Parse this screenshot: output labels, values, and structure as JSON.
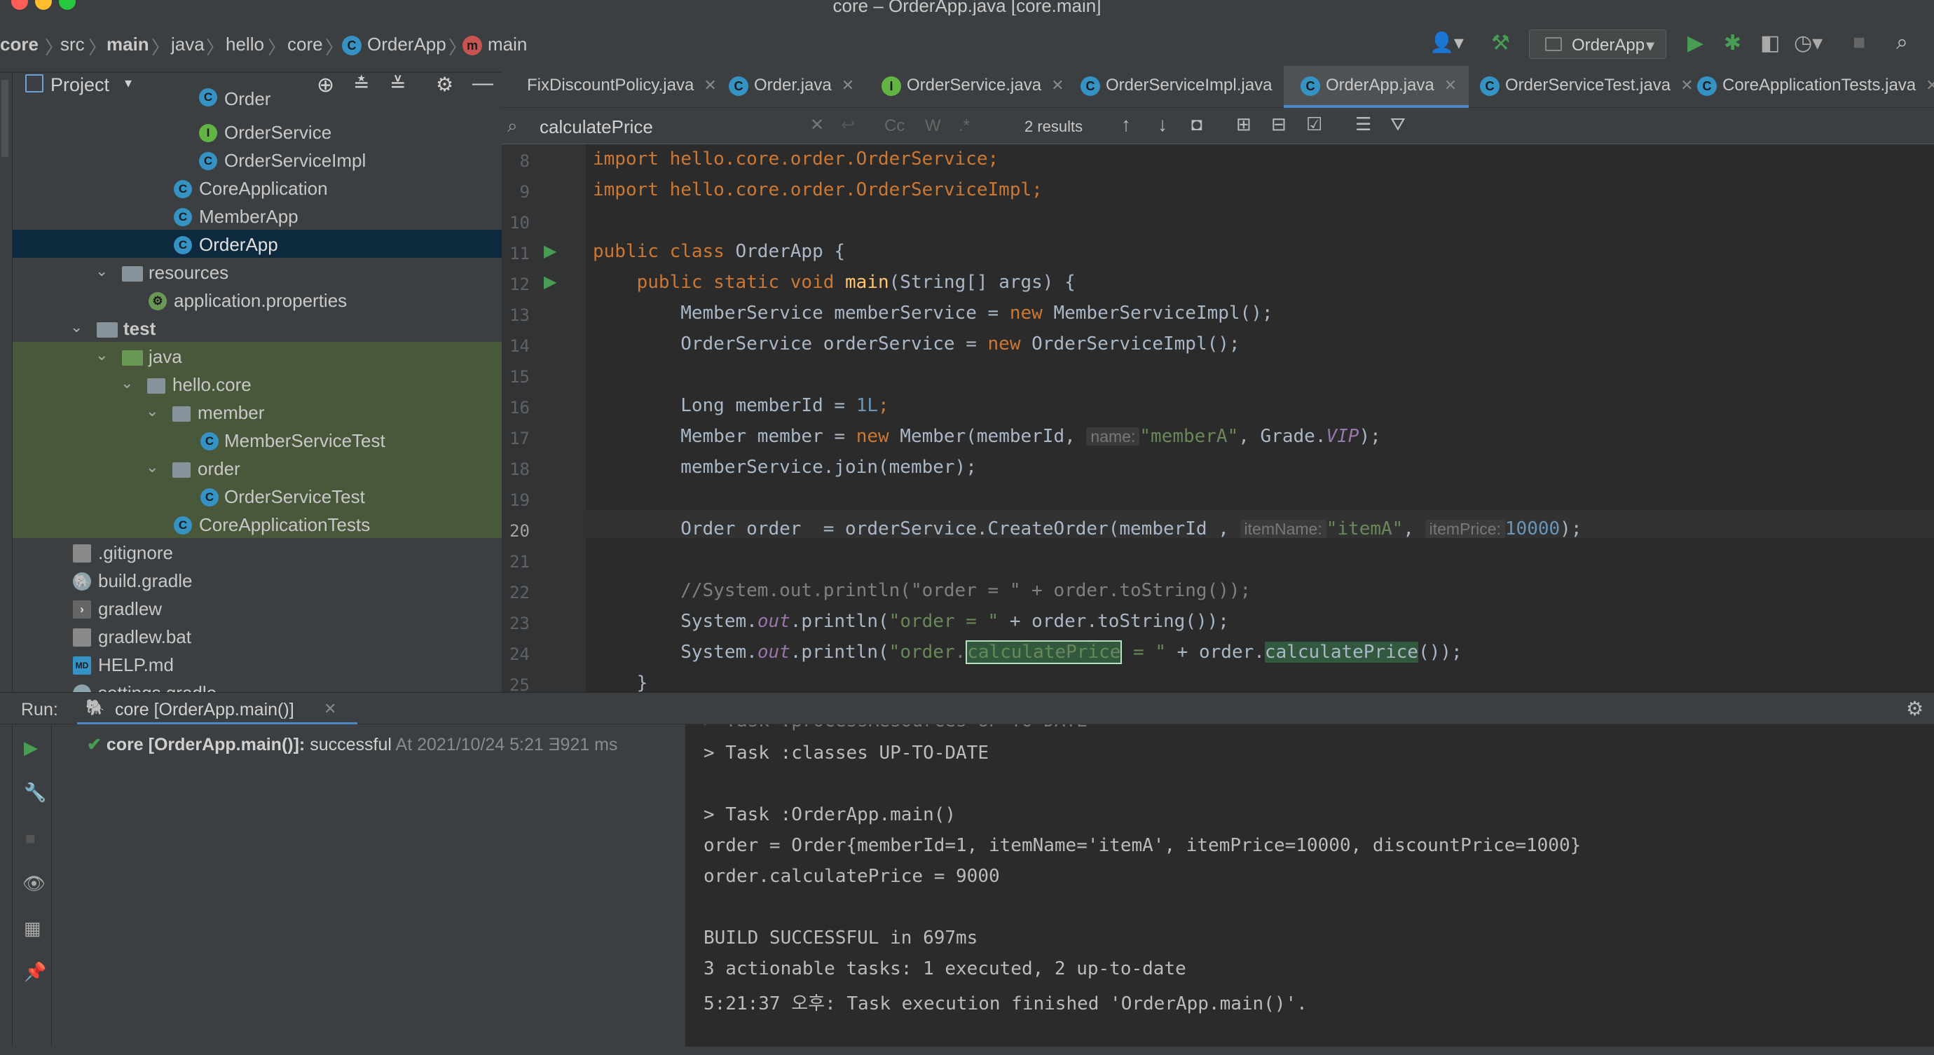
{
  "window": {
    "title": "core – OrderApp.java [core.main]"
  },
  "breadcrumb": [
    "core",
    "src",
    "main",
    "java",
    "hello",
    "core",
    "OrderApp",
    "main"
  ],
  "toolbar": {
    "run_config": "OrderApp"
  },
  "project_panel": {
    "title": "Project",
    "tree": [
      {
        "label": "Order",
        "icon": "class"
      },
      {
        "label": "OrderService",
        "icon": "interface"
      },
      {
        "label": "OrderServiceImpl",
        "icon": "class"
      },
      {
        "label": "CoreApplication",
        "icon": "spring-class"
      },
      {
        "label": "MemberApp",
        "icon": "class"
      },
      {
        "label": "OrderApp",
        "icon": "class",
        "selected": true
      },
      {
        "label": "resources",
        "icon": "folder"
      },
      {
        "label": "application.properties",
        "icon": "properties"
      },
      {
        "label": "test",
        "icon": "folder"
      },
      {
        "label": "java",
        "icon": "folder"
      },
      {
        "label": "hello.core",
        "icon": "package"
      },
      {
        "label": "member",
        "icon": "package"
      },
      {
        "label": "MemberServiceTest",
        "icon": "test-class"
      },
      {
        "label": "order",
        "icon": "package"
      },
      {
        "label": "OrderServiceTest",
        "icon": "test-class"
      },
      {
        "label": "CoreApplicationTests",
        "icon": "test-class"
      },
      {
        "label": ".gitignore",
        "icon": "file"
      },
      {
        "label": "build.gradle",
        "icon": "gradle"
      },
      {
        "label": "gradlew",
        "icon": "file"
      },
      {
        "label": "gradlew.bat",
        "icon": "file"
      },
      {
        "label": "HELP.md",
        "icon": "markdown"
      },
      {
        "label": "settings.gradle",
        "icon": "gradle"
      }
    ]
  },
  "tabs": [
    "FixDiscountPolicy.java",
    "Order.java",
    "OrderService.java",
    "OrderServiceImpl.java",
    "OrderApp.java",
    "OrderServiceTest.java",
    "CoreApplicationTests.java"
  ],
  "active_tab": "OrderApp.java",
  "search": {
    "query": "calculatePrice",
    "results": "2 results",
    "cc": "Cc",
    "w": "W",
    "regex": ".*"
  },
  "editor": {
    "line_numbers": [
      "8",
      "9",
      "10",
      "11",
      "12",
      "13",
      "14",
      "15",
      "16",
      "17",
      "18",
      "19",
      "20",
      "21",
      "22",
      "23",
      "24",
      "25"
    ],
    "lines": {
      "l8": "import hello.core.order.OrderService;",
      "l9": "import hello.core.order.OrderServiceImpl;",
      "l11a": "public class ",
      "l11b": "OrderApp {",
      "l12a": "    public static void ",
      "l12b": "main",
      "l12c": "(String[] args) {",
      "l13a": "        MemberService memberService = ",
      "l13b": "new",
      "l13c": " MemberServiceImpl();",
      "l14a": "        OrderService orderService = ",
      "l14b": "new",
      "l14c": " OrderServiceImpl();",
      "l16a": "        Long memberId = ",
      "l16b": "1L",
      "l16c": ";",
      "l17a": "        Member member = ",
      "l17b": "new",
      "l17c": " Member(memberId, ",
      "l17hint": "name:",
      "l17d": "\"memberA\"",
      "l17e": ", Grade.",
      "l17f": "VIP",
      "l17g": ");",
      "l18": "        memberService.join(member);",
      "l20a": "        Order order  = orderService.CreateOrder(memberId , ",
      "l20hint1": "itemName:",
      "l20b": "\"itemA\"",
      "l20c": ", ",
      "l20hint2": "itemPrice:",
      "l20d": "10000",
      "l20e": ");",
      "l22": "        //System.out.println(\"order = \" + order.toString());",
      "l23a": "        System.",
      "l23b": "out",
      "l23c": ".println(",
      "l23d": "\"order = \"",
      "l23e": " + order.toString());",
      "l24a": "        System.",
      "l24b": "out",
      "l24c": ".println(",
      "l24d": "\"order.",
      "l24e": "calculatePrice",
      "l24f": " = \"",
      "l24g": " + order.",
      "l24h": "calculatePrice",
      "l24i": "());",
      "l25": "    }"
    }
  },
  "run": {
    "label": "Run:",
    "tab": "core [OrderApp.main()]",
    "tree_item": "core [OrderApp.main()]:",
    "status": "successful",
    "timestamp": "At 2021/10/24 5:21 Ǝ",
    "duration": "921 ms",
    "console": [
      "> Task :processResources UP-TO-DATE",
      "> Task :classes UP-TO-DATE",
      "",
      "> Task :OrderApp.main()",
      "order = Order{memberId=1, itemName='itemA', itemPrice=10000, discountPrice=1000}",
      "order.calculatePrice = 9000",
      "",
      "BUILD SUCCESSFUL in 697ms",
      "3 actionable tasks: 1 executed, 2 up-to-date",
      "5:21:37 오후: Task execution finished 'OrderApp.main()'."
    ]
  },
  "colors": {
    "accent": "#4a88c7",
    "keyword": "#cc7832",
    "string": "#6a8759",
    "number": "#6897bb",
    "run_green": "#499c54"
  }
}
